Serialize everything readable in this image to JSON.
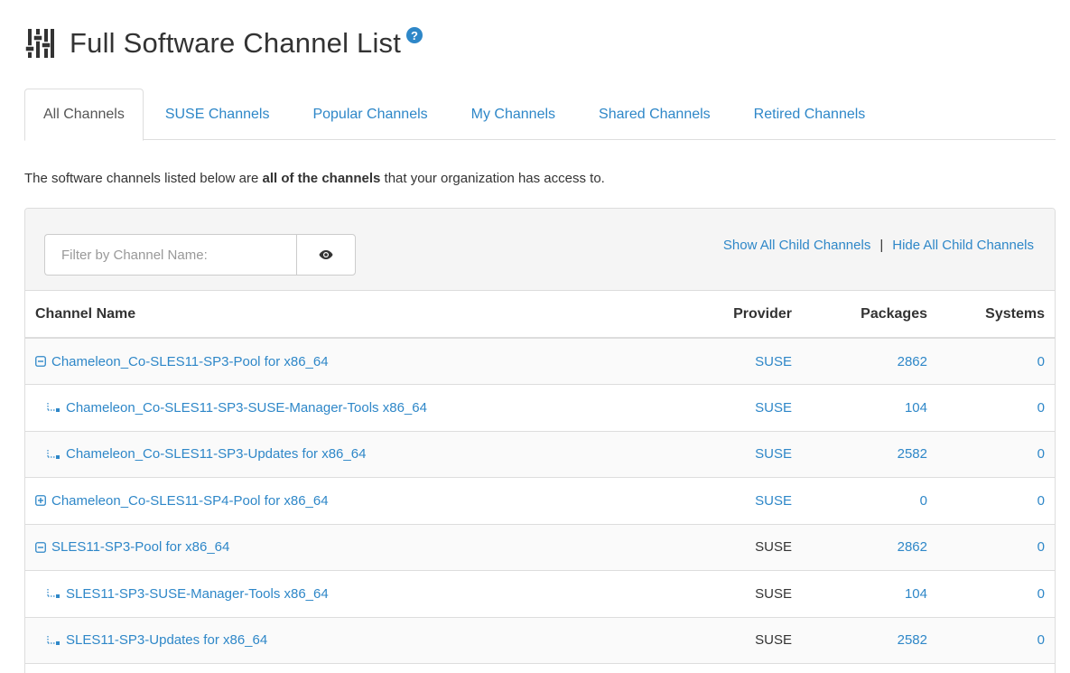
{
  "header": {
    "title": "Full Software Channel List",
    "title_icon": "sliders-icon",
    "help_icon": "question-circle-icon"
  },
  "tabs": [
    {
      "label": "All Channels",
      "active": true
    },
    {
      "label": "SUSE Channels",
      "active": false
    },
    {
      "label": "Popular Channels",
      "active": false
    },
    {
      "label": "My Channels",
      "active": false
    },
    {
      "label": "Shared Channels",
      "active": false
    },
    {
      "label": "Retired Channels",
      "active": false
    }
  ],
  "description": {
    "prefix": "The software channels listed below are ",
    "bold": "all of the channels",
    "suffix": " that your organization has access to."
  },
  "filter": {
    "placeholder": "Filter by Channel Name:",
    "value": "",
    "button_icon": "eye-icon"
  },
  "child_links": {
    "show": "Show All Child Channels",
    "separator": "|",
    "hide": "Hide All Child Channels"
  },
  "table": {
    "columns": [
      "Channel Name",
      "Provider",
      "Packages",
      "Systems"
    ],
    "rows": [
      {
        "name": "Chameleon_Co-SLES11-SP3-Pool for x86_64",
        "level": "parent",
        "toggle": "collapse",
        "provider": "SUSE",
        "provider_link": true,
        "packages": "2862",
        "systems": "0"
      },
      {
        "name": "Chameleon_Co-SLES11-SP3-SUSE-Manager-Tools x86_64",
        "level": "child",
        "toggle": "",
        "provider": "SUSE",
        "provider_link": true,
        "packages": "104",
        "systems": "0"
      },
      {
        "name": "Chameleon_Co-SLES11-SP3-Updates for x86_64",
        "level": "child",
        "toggle": "",
        "provider": "SUSE",
        "provider_link": true,
        "packages": "2582",
        "systems": "0"
      },
      {
        "name": "Chameleon_Co-SLES11-SP4-Pool for x86_64",
        "level": "parent",
        "toggle": "expand",
        "provider": "SUSE",
        "provider_link": true,
        "packages": "0",
        "systems": "0"
      },
      {
        "name": "SLES11-SP3-Pool for x86_64",
        "level": "parent",
        "toggle": "collapse",
        "provider": "SUSE",
        "provider_link": false,
        "packages": "2862",
        "systems": "0"
      },
      {
        "name": "SLES11-SP3-SUSE-Manager-Tools x86_64",
        "level": "child",
        "toggle": "",
        "provider": "SUSE",
        "provider_link": false,
        "packages": "104",
        "systems": "0"
      },
      {
        "name": "SLES11-SP3-Updates for x86_64",
        "level": "child",
        "toggle": "",
        "provider": "SUSE",
        "provider_link": false,
        "packages": "2582",
        "systems": "0"
      }
    ]
  },
  "colors": {
    "link": "#2e87c8",
    "text": "#333333",
    "border": "#dddddd",
    "panel_bg": "#f5f5f5"
  }
}
